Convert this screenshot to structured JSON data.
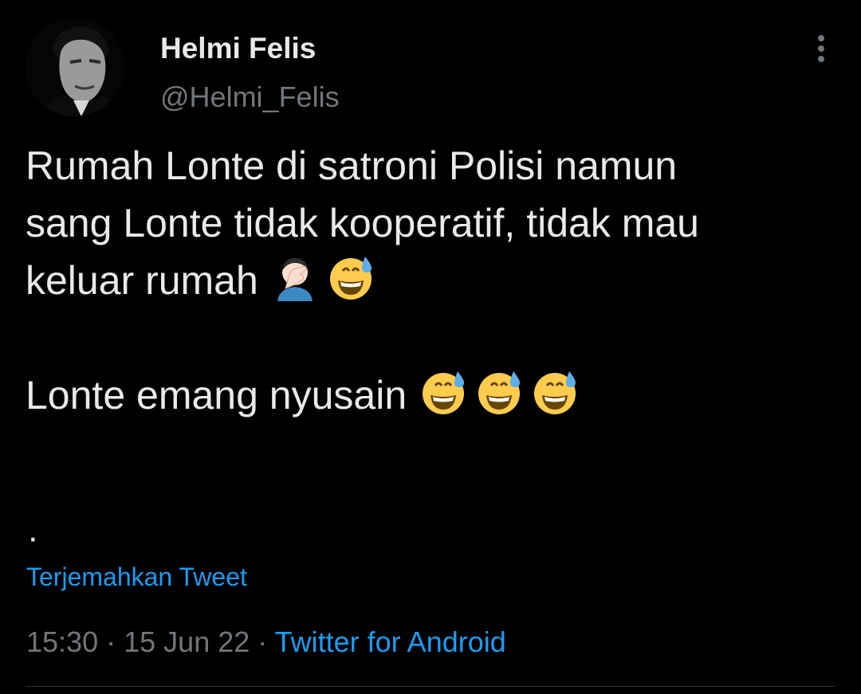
{
  "tweet": {
    "author": {
      "display_name": "Helmi Felis",
      "handle": "@Helmi_Felis"
    },
    "text_lines": [
      "Rumah Lonte di satroni Polisi namun",
      "sang Lonte tidak kooperatif, tidak mau",
      "keluar rumah"
    ],
    "text_line_2": "Lonte emang nyusain",
    "dot": "·",
    "translate_label": "Terjemahkan Tweet",
    "time": "15:30",
    "date": "15 Jun 22",
    "separator": "·",
    "source": "Twitter for Android",
    "emoji_names": [
      "face-palm-emoji",
      "grinning-sweat-emoji",
      "grinning-sweat-emoji",
      "grinning-sweat-emoji",
      "grinning-sweat-emoji"
    ]
  },
  "colors": {
    "background": "#000000",
    "primary_text": "#e7e9ea",
    "secondary_text": "#71767b",
    "link": "#1d9bf0",
    "divider": "#2f3336"
  }
}
